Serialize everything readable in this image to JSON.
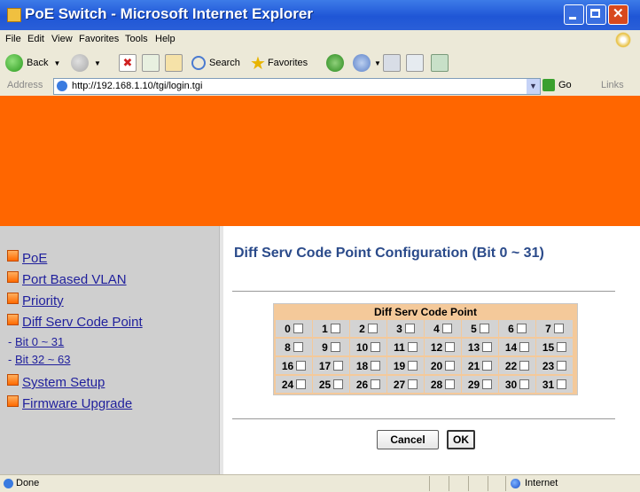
{
  "window": {
    "title": "PoE Switch - Microsoft Internet Explorer"
  },
  "menu": [
    "File",
    "Edit",
    "View",
    "Favorites",
    "Tools",
    "Help"
  ],
  "toolbar": {
    "back": "Back",
    "search": "Search",
    "favorites": "Favorites"
  },
  "address": {
    "label": "Address",
    "url": "http://192.168.1.10/tgi/login.tgi",
    "go": "Go",
    "links": "Links"
  },
  "banner_color": "#ff6600",
  "sidebar": {
    "items": [
      {
        "label": "PoE"
      },
      {
        "label": "Port Based VLAN"
      },
      {
        "label": "Priority"
      },
      {
        "label": "Diff Serv Code Point"
      }
    ],
    "subitems": [
      {
        "label": "Bit 0 ~ 31"
      },
      {
        "label": "Bit 32 ~ 63"
      }
    ],
    "items2": [
      {
        "label": "System Setup"
      },
      {
        "label": "Firmware Upgrade"
      }
    ]
  },
  "main": {
    "title": "Diff Serv Code Point Configuration (Bit 0 ~ 31)",
    "table_header": "Diff Serv Code Point",
    "bits": [
      "0",
      "1",
      "2",
      "3",
      "4",
      "5",
      "6",
      "7",
      "8",
      "9",
      "10",
      "11",
      "12",
      "13",
      "14",
      "15",
      "16",
      "17",
      "18",
      "19",
      "20",
      "21",
      "22",
      "23",
      "24",
      "25",
      "26",
      "27",
      "28",
      "29",
      "30",
      "31"
    ],
    "cancel": "Cancel",
    "ok": "OK"
  },
  "status": {
    "text": "Done",
    "zone": "Internet"
  }
}
